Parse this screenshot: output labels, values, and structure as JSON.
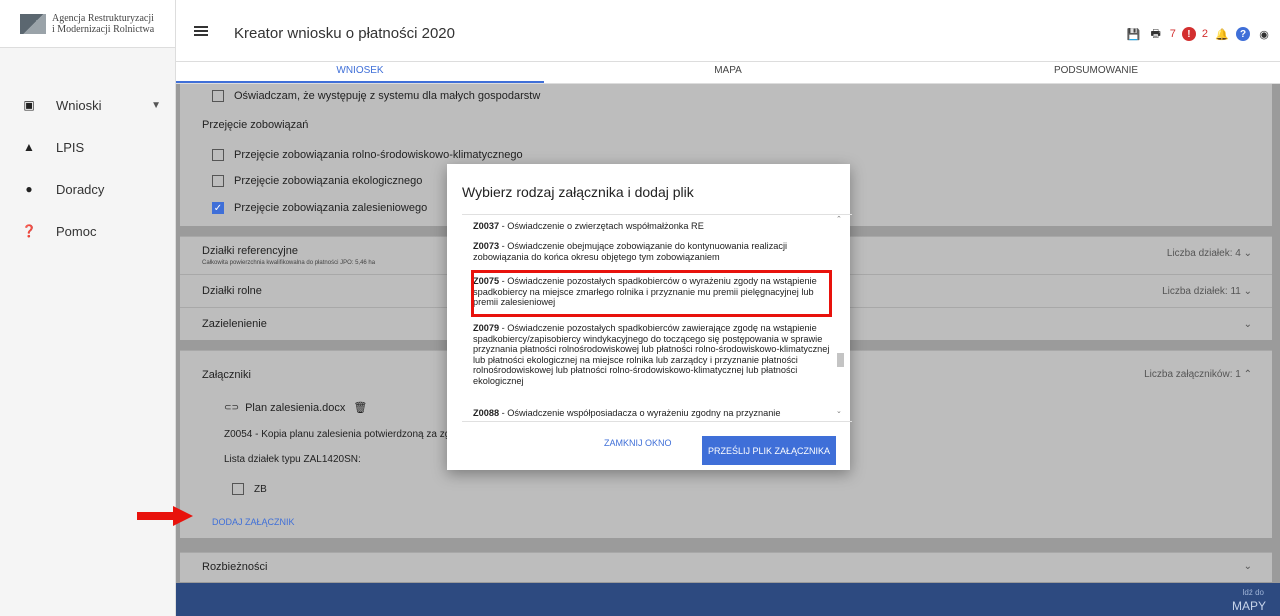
{
  "sidebar": {
    "logo_line1": "Agencja Restrukturyzacji",
    "logo_line2": "i Modernizacji Rolnictwa",
    "items": [
      {
        "label": "Wnioski",
        "icon": "clipboard-icon"
      },
      {
        "label": "LPIS",
        "icon": "mountain-icon"
      },
      {
        "label": "Doradcy",
        "icon": "person-icon"
      },
      {
        "label": "Pomoc",
        "icon": "help-icon"
      }
    ]
  },
  "header": {
    "title": "Kreator wniosku o płatności 2020",
    "warning_count": "7",
    "notification_count": "2"
  },
  "tabs": [
    "WNIOSEK",
    "MAPA",
    "PODSUMOWANIE"
  ],
  "form": {
    "small_farms": "Oświadczam, że występuję z systemu dla małych gospodarstw",
    "takeover_heading": "Przejęcie zobowiązań",
    "takeover_agri_env": "Przejęcie zobowiązania rolno-środowiskowo-klimatycznego",
    "takeover_eco": "Przejęcie zobowiązania ekologicznego",
    "takeover_forest": "Przejęcie zobowiązania zalesieniowego"
  },
  "sections": {
    "ref_plots": "Działki referencyjne",
    "ref_plots_sub": "Całkowita powierzchnia kwalifikowalna do płatności JPO: 5,46 ha",
    "ref_plots_count": "Liczba działek: 4",
    "agri_plots": "Działki rolne",
    "agri_plots_count": "Liczba działek: 11",
    "greening": "Zazielenienie",
    "attachments": "Załączniki",
    "attachments_count": "Liczba załączników: 1",
    "file_name": "Plan zalesienia.docx",
    "file_desc": "Z0054 - Kopia planu zalesienia potwierdzoną za zg",
    "plot_list_label": "Lista działek typu ZAL1420SN:",
    "plot_zb": "ZB",
    "add_attachment": "DODAJ ZAŁĄCZNIK",
    "discrepancies": "Rozbieżności"
  },
  "footer": {
    "go_to": "Idź do",
    "maps": "MAPY"
  },
  "modal": {
    "title": "Wybierz rodzaj załącznika i dodaj plik",
    "options": [
      {
        "code": "Z0037",
        "text": " - Oświadczenie o zwierzętach współmałżonka RE"
      },
      {
        "code": "Z0073",
        "text": " - Oświadczenie obejmujące zobowiązanie do kontynuowania realizacji zobowiązania do końca okresu objętego tym zobowiązaniem"
      },
      {
        "code": "Z0075",
        "text": " - Oświadczenie pozostałych spadkobierców o wyrażeniu zgody na wstąpienie spadkobiercy na miejsce zmarłego rolnika i przyznanie mu premii pielęgnacyjnej lub premii zalesieniowej"
      },
      {
        "code": "Z0079",
        "text": " - Oświadczenie pozostałych spadkobierców zawierające zgodę na wstąpienie spadkobiercy/zapisobiercy windykacyjnego do toczącego się postępowania w sprawie przyznania płatności rolnośrodowiskowej lub płatności rolno-środowiskowo-klimatycznej lub płatności ekologicznej na miejsce rolnika lub zarządcy i przyznanie płatności rolnośrodowiskowej lub płatności rolno-środowiskowo-klimatycznej lub płatności ekologicznej"
      },
      {
        "code": "Z0088",
        "text": " - Oświadczenie współposiadacza o wyrażeniu zgodny na przyznanie"
      }
    ],
    "close_label": "ZAMKNIJ OKNO",
    "send_label": "PRZEŚLIJ PLIK ZAŁĄCZNIKA"
  }
}
